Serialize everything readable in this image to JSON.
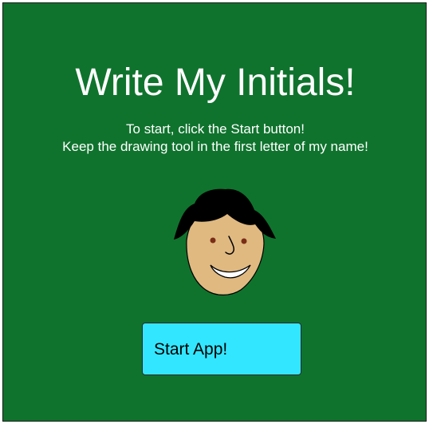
{
  "app": {
    "title": "Write My Initials!",
    "instructions": [
      "To start, click the Start button!",
      "Keep the drawing tool in the first letter of my name!"
    ],
    "start_button_label": "Start App!"
  },
  "colors": {
    "background": "#0f732d",
    "button": "#33e6ff",
    "text": "#ffffff",
    "skin": "#e0b981",
    "hair": "#000000"
  },
  "icons": {
    "character": "cartoon-face-icon"
  }
}
